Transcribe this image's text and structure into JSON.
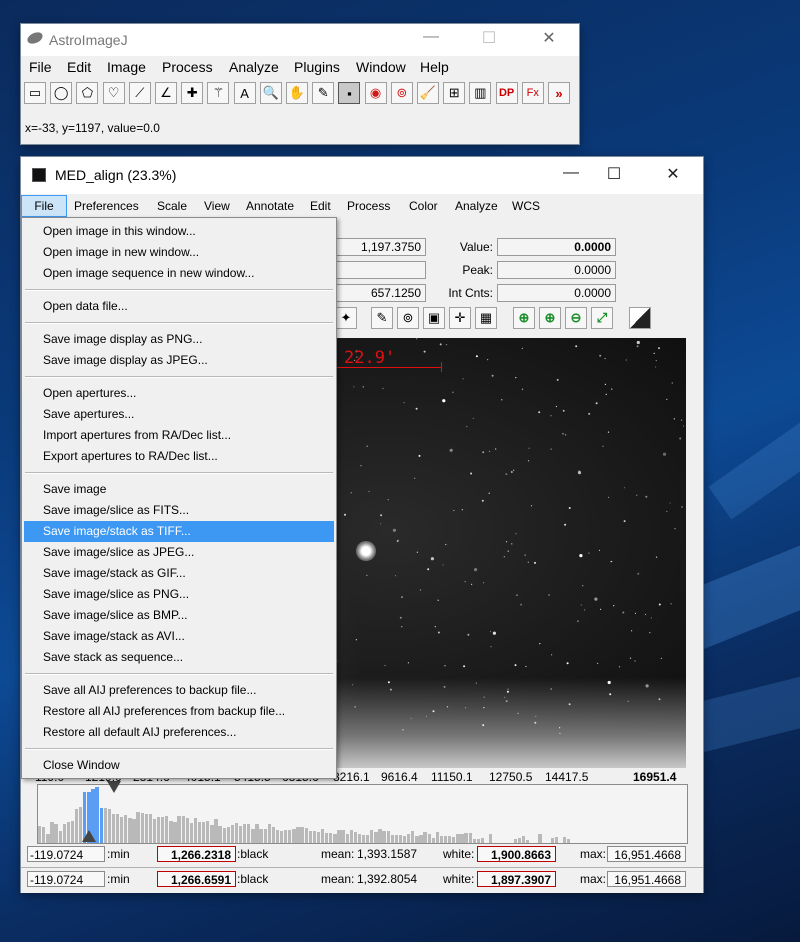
{
  "desktop": {
    "background_colors": [
      "#0b2a5c",
      "#0d4a95",
      "#071a3d"
    ]
  },
  "main_window": {
    "title": "AstroImageJ",
    "menu": [
      "File",
      "Edit",
      "Image",
      "Process",
      "Analyze",
      "Plugins",
      "Window",
      "Help"
    ],
    "toolbar_icons": [
      "rectangle-tool-icon",
      "oval-tool-icon",
      "polygon-tool-icon",
      "freehand-tool-icon",
      "line-tool-icon",
      "angle-tool-icon",
      "point-tool-icon",
      "wand-tool-icon",
      "text-tool-icon",
      "magnifier-tool-icon",
      "hand-tool-icon",
      "dropper-tool-icon",
      "astro-tool-icon",
      "aperture-tool-icon",
      "multi-aperture-tool-icon",
      "broom-tool-icon",
      "align-tool-icon",
      "table-tool-icon",
      "dp-tool-icon",
      "fx-tool-icon",
      "more-tools-icon"
    ],
    "toolbar_glyphs": [
      "▭",
      "◯",
      "⬠",
      "♡",
      "⟋",
      "∠",
      "✚",
      "⚚",
      "A",
      "🔍",
      "✋",
      "✎",
      "▪",
      "◉",
      "⊚",
      "🧹",
      "⊞",
      "▥",
      "DP",
      "Fx",
      "»"
    ],
    "status": "x=-33, y=1197, value=0.0"
  },
  "image_window": {
    "title": "MED_align (23.3%)",
    "menu": [
      "File",
      "Preferences",
      "Scale",
      "View",
      "Annotate",
      "Edit",
      "Process",
      "Color",
      "Analyze",
      "WCS"
    ],
    "fields": {
      "row1_value": "1,197.3750",
      "row3_value": "657.1250",
      "value_label": "Value:",
      "value": "0.0000",
      "peak_label": "Peak:",
      "peak": "0.0000",
      "intcnts_label": "Int Cnts:",
      "intcnts": "0.0000"
    },
    "toolbar2_glyphs": [
      "✦",
      "✎",
      "⊚",
      "▣",
      "✛",
      "▦",
      "⊕",
      "⊕",
      "⊖",
      "⤢",
      "◩"
    ],
    "toolbar2_icons": [
      "settings-icon",
      "draw-icon",
      "apertures-icon",
      "clear-icon",
      "center-icon",
      "table-icon",
      "zoom-in-plus-icon",
      "zoom-in-icon",
      "zoom-out-icon",
      "zoom-fit-icon",
      "contrast-icon"
    ],
    "scale_label": "22.9'",
    "axis_values": [
      "-119.0",
      "1219.0",
      "2814.6",
      "4015.1",
      "5415.5",
      "6815.6",
      "8216.1",
      "9616.4",
      "11150.1",
      "12750.5",
      "14417.5",
      "16951.4"
    ],
    "stats_row1": {
      "min_value": "-119.0724",
      "min_label": ":min",
      "black_value": "1,266.2318",
      "black_label": ":black",
      "mean_label": "mean:",
      "mean_value": "1,393.1587",
      "white_label": "white:",
      "white_value": "1,900.8663",
      "max_label": "max:",
      "max_value": "16,951.4668"
    },
    "stats_row2": {
      "min_value": "-119.0724",
      "min_label": ":min",
      "black_value": "1,266.6591",
      "black_label": ":black",
      "mean_label": "mean:",
      "mean_value": "1,392.8054",
      "white_label": "white:",
      "white_value": "1,897.3907",
      "max_label": "max:",
      "max_value": "16,951.4668"
    }
  },
  "file_menu": {
    "groups": [
      [
        "Open image in this window...",
        "Open image in new window...",
        "Open image sequence in new window..."
      ],
      [
        "Open data file..."
      ],
      [
        "Save image display as PNG...",
        "Save image display as JPEG..."
      ],
      [
        "Open apertures...",
        "Save apertures...",
        "Import apertures from RA/Dec list...",
        "Export apertures to RA/Dec list..."
      ],
      [
        "Save image",
        "Save image/slice as FITS...",
        "Save image/stack as TIFF...",
        "Save image/slice as JPEG...",
        "Save image/stack as GIF...",
        "Save image/slice as PNG...",
        "Save image/slice as BMP...",
        "Save image/stack as AVI...",
        "Save stack as sequence..."
      ],
      [
        "Save all AIJ preferences to backup file...",
        "Restore all AIJ preferences from backup file...",
        "Restore all default AIJ preferences..."
      ],
      [
        "Close Window"
      ]
    ],
    "selected": "Save image/stack as TIFF..."
  }
}
